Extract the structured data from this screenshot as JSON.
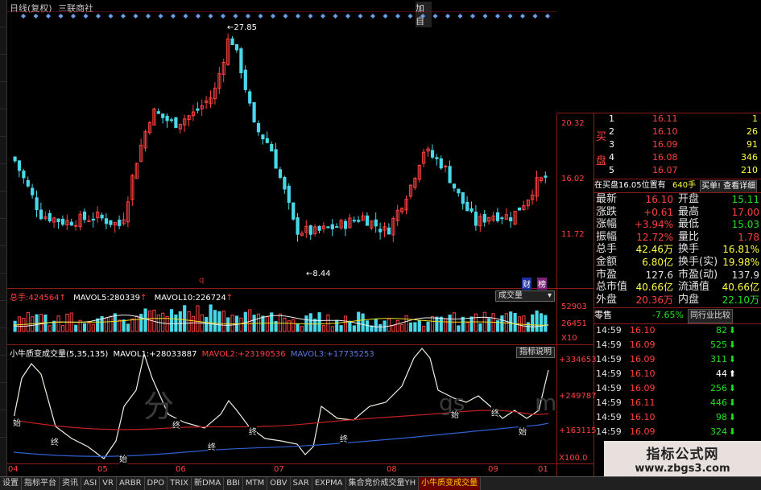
{
  "header": {
    "period": "日线(复权)",
    "stock_name": "三联商社",
    "corner": "加自"
  },
  "main_chart": {
    "price_labels": [
      "20.32",
      "16.02",
      "11.72"
    ],
    "max_label": "27.85",
    "min_label": "8.44",
    "q_marker": "q",
    "badges": [
      "财",
      "榜"
    ]
  },
  "volume_panel": {
    "total_label": "总手:",
    "total_value": "424564",
    "ma5_label": "MAVOL5:",
    "ma5_value": "280339",
    "ma10_label": "MAVOL10:",
    "ma10_value": "226724",
    "selector": "成交量",
    "axis_labels": [
      "52903",
      "26451",
      "X10"
    ]
  },
  "indicator_panel": {
    "title": "小牛质变成交量(5,35,135)",
    "m1_label": "MAVOL1:",
    "m1_value": "+28033887",
    "m2_label": "MAVOL2:",
    "m2_value": "+23190536",
    "m3_label": "MAVOL3:",
    "m3_value": "+17735253",
    "explain_button": "指标说明",
    "axis_labels": [
      "+334653",
      "+249787",
      "+163115",
      "X100.0"
    ],
    "event_labels": [
      "始",
      "终",
      "始",
      "终",
      "终",
      "终",
      "终",
      "始",
      "终",
      "始"
    ]
  },
  "date_axis": [
    "04",
    "05",
    "06",
    "07",
    "08",
    "09",
    "01"
  ],
  "watermark": {
    "left": "分",
    "mid": "gs",
    "right": "m"
  },
  "order_book": {
    "side_buy_chars": [
      "买",
      "盘"
    ],
    "rows": [
      {
        "n": "1",
        "price": "16.11",
        "vol": "1"
      },
      {
        "n": "2",
        "price": "16.10",
        "vol": "26"
      },
      {
        "n": "3",
        "price": "16.09",
        "vol": "91"
      },
      {
        "n": "4",
        "price": "16.08",
        "vol": "346"
      },
      {
        "n": "5",
        "price": "16.07",
        "vol": "210"
      }
    ],
    "status_text": "在买盘16.05位置有",
    "status_vol": "640手",
    "detail_button": "买单! 查看详细"
  },
  "quote": {
    "rows": [
      {
        "l1": "最新",
        "v1": "16.10",
        "l2": "开盘",
        "v2": "15.11"
      },
      {
        "l1": "涨跌",
        "v1": "+0.61",
        "l2": "最高",
        "v2": "17.00"
      },
      {
        "l1": "涨幅",
        "v1": "+3.94%",
        "l2": "最低",
        "v2": "15.03"
      },
      {
        "l1": "振幅",
        "v1": "12.72%",
        "l2": "量比",
        "v2": "1.78"
      },
      {
        "l1": "总手",
        "v1": "42.46万",
        "l2": "换手",
        "v2": "16.81%"
      },
      {
        "l1": "金额",
        "v1": "6.80亿",
        "l2": "换手(实)",
        "v2": "19.98%"
      },
      {
        "l1": "市盈",
        "v1": "127.6",
        "l2": "市盈(动)",
        "v2": "137.9"
      },
      {
        "l1": "总市值",
        "v1": "40.66亿",
        "l2": "流通值",
        "v2": "40.66亿"
      },
      {
        "l1": "外盘",
        "v1": "20.36万",
        "l2": "内盘",
        "v2": "22.10万"
      }
    ]
  },
  "industry": {
    "name": "零售",
    "pct": "-7.65%",
    "button": "同行业比较"
  },
  "ticks": [
    {
      "t": "14:59",
      "p": "16.10",
      "v": "82",
      "dir": "down"
    },
    {
      "t": "14:59",
      "p": "16.09",
      "v": "525",
      "dir": "down"
    },
    {
      "t": "14:59",
      "p": "16.09",
      "v": "311",
      "dir": "down"
    },
    {
      "t": "14:59",
      "p": "16.10",
      "v": "44",
      "dir": "up"
    },
    {
      "t": "14:59",
      "p": "16.09",
      "v": "256",
      "dir": "down"
    },
    {
      "t": "14:59",
      "p": "16.11",
      "v": "446",
      "dir": "down"
    },
    {
      "t": "14:59",
      "p": "16.10",
      "v": "98",
      "dir": "down"
    },
    {
      "t": "14:59",
      "p": "16.09",
      "v": "324",
      "dir": "down"
    }
  ],
  "logo": {
    "title": "指标公式网",
    "url": "www.zbgs3.com"
  },
  "tabs": [
    "设置",
    "指标平台",
    "资讯",
    "ASI",
    "VR",
    "ARBR",
    "DPO",
    "TRIX",
    "新DMA",
    "BBI",
    "MTM",
    "OBV",
    "SAR",
    "EXPMA",
    "集合竞价成交量YH",
    "小牛质变成交量"
  ],
  "colors": {
    "up": "#ff4040",
    "down": "#48d8e8",
    "frame": "#8b1a1a"
  }
}
